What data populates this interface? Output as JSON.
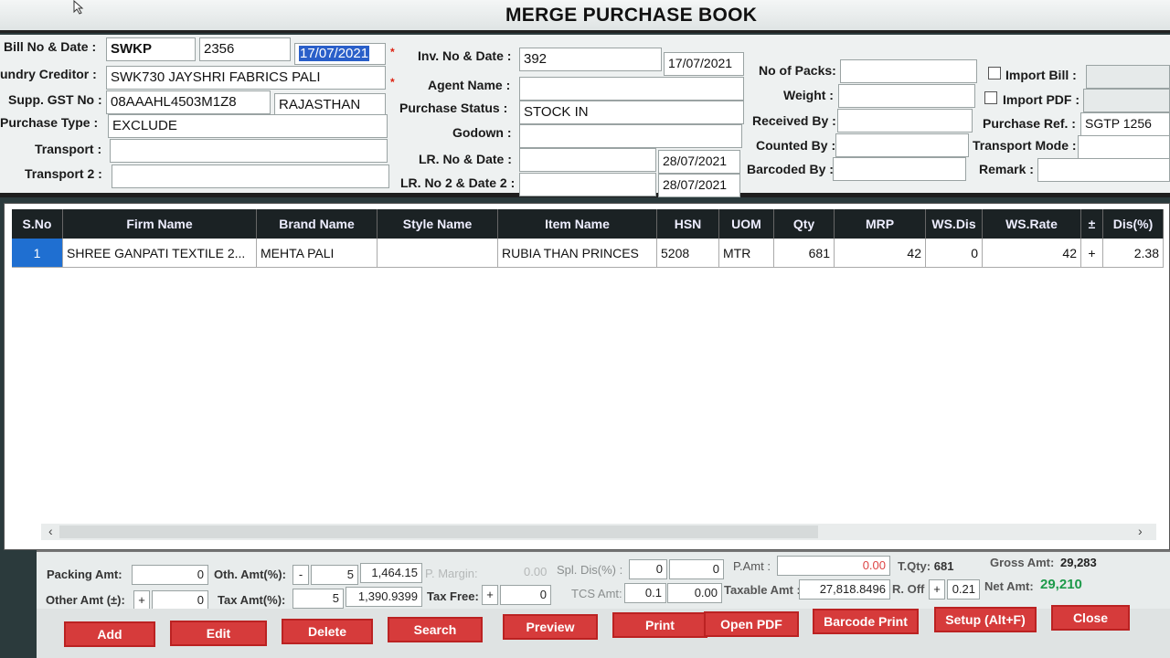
{
  "title": "MERGE PURCHASE BOOK",
  "header": {
    "bill_label": "Bill No & Date :",
    "bill_prefix": "SWKP",
    "bill_no": "2356",
    "bill_date": "17/07/2021",
    "creditor_label": "undry Creditor :",
    "creditor": "SWK730 JAYSHRI FABRICS PALI",
    "gst_label": "Supp. GST No :",
    "gst_no": "08AAAHL4503M1Z8",
    "state": "RAJASTHAN",
    "ptype_label": "Purchase Type :",
    "ptype": "EXCLUDE",
    "transport_label": "Transport :",
    "transport": "",
    "transport2_label": "Transport 2 :",
    "transport2": "",
    "inv_label": "Inv. No & Date :",
    "inv_no": "392",
    "inv_date": "17/07/2021",
    "agent_label": "Agent Name :",
    "agent": "",
    "status_label": "Purchase Status :",
    "status": "STOCK IN",
    "godown_label": "Godown :",
    "godown": "",
    "lr_label": "LR. No & Date :",
    "lr_no": "",
    "lr_date": "28/07/2021",
    "lr2_label": "LR. No 2 & Date 2 :",
    "lr2_no": "",
    "lr2_date": "28/07/2021",
    "packs_label": "No of Packs:",
    "weight_label": "Weight :",
    "received_label": "Received By :",
    "counted_label": "Counted By :",
    "barcoded_label": "Barcoded By :",
    "import_bill_label": "Import Bill  :",
    "import_pdf_label": "Import PDF :",
    "pref_label": "Purchase Ref. :",
    "pref": "SGTP 1256",
    "tmode_label": "Transport Mode :",
    "remark_label": "Remark :"
  },
  "grid": {
    "columns": [
      "S.No",
      "Firm Name",
      "Brand Name",
      "Style Name",
      "Item Name",
      "HSN",
      "UOM",
      "Qty",
      "MRP",
      "WS.Dis",
      "WS.Rate",
      "±",
      "Dis(%)"
    ],
    "rows": [
      [
        "1",
        "SHREE GANPATI TEXTILE 2...",
        "MEHTA PALI",
        "",
        "RUBIA THAN PRINCES",
        "5208",
        "MTR",
        "681",
        "42",
        "0",
        "42",
        "+",
        "2.38"
      ]
    ]
  },
  "footer": {
    "packing_label": "Packing Amt:",
    "packing": "0",
    "oth_label": "Oth. Amt(%):",
    "oth_sign": "-",
    "oth_pct": "5",
    "oth_amt": "1,464.15",
    "pmargin_label": "P. Margin:",
    "pmargin": "0.00",
    "spl_label": "Spl. Dis(%) :",
    "spl_pct": "0",
    "spl_amt": "0",
    "pamt_label": "P.Amt :",
    "pamt": "0.00",
    "tqty_label": "T.Qty:",
    "tqty": "681",
    "gross_label": "Gross Amt:",
    "gross": "29,283",
    "other_label": "Other Amt (±):",
    "other_sign": "+",
    "other": "0",
    "tax_label": "Tax Amt(%):",
    "tax_pct": "5",
    "tax_amt": "1,390.9399",
    "taxfree_label": "Tax Free:",
    "taxfree_sign": "+",
    "taxfree": "0",
    "tcs_label": "TCS Amt:",
    "tcs_pct": "0.1",
    "tcs_amt": "0.00",
    "taxable_label": "Taxable Amt :",
    "taxable": "27,818.8496",
    "roff_label": "R. Off :",
    "roff_sign": "+",
    "roff": "0.21",
    "net_label": "Net Amt:",
    "net": "29,210"
  },
  "buttons": {
    "add": "Add",
    "edit": "Edit",
    "delete": "Delete",
    "search": "Search",
    "preview": "Preview",
    "print": "Print",
    "open_pdf": "Open PDF",
    "barcode": "Barcode Print",
    "setup": "Setup (Alt+F)",
    "close": "Close"
  }
}
